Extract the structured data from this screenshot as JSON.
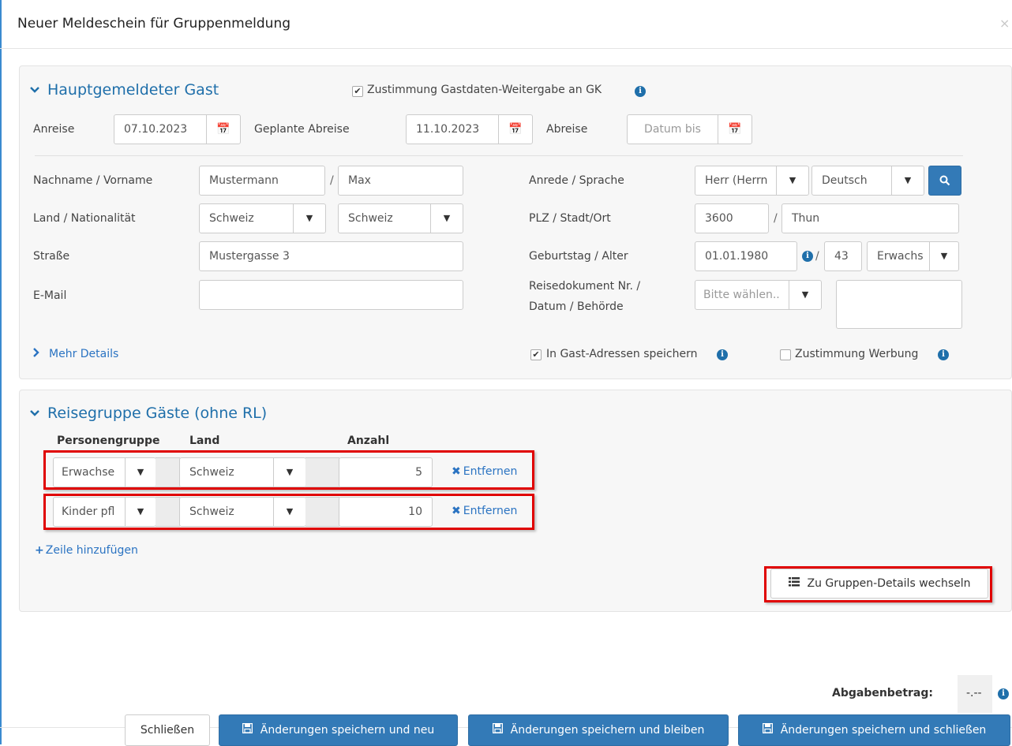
{
  "modal": {
    "title": "Neuer Meldeschein für Gruppenmeldung",
    "close": "×"
  },
  "main_guest": {
    "heading": "Hauptgemeldeter Gast",
    "consent_label": "Zustimmung Gastdaten-Weitergabe an GK",
    "consent_checked": true,
    "arrival_label": "Anreise",
    "arrival_value": "07.10.2023",
    "planned_departure_label": "Geplante Abreise",
    "planned_departure_value": "11.10.2023",
    "departure_label": "Abreise",
    "departure_placeholder": "Datum bis",
    "name_label": "Nachname / Vorname",
    "last_name": "Mustermann",
    "first_name": "Max",
    "salutation_label": "Anrede / Sprache",
    "salutation_value": "Herr (Herrn",
    "language_value": "Deutsch",
    "country_label": "Land / Nationalität",
    "country_value": "Schweiz",
    "nationality_value": "Schweiz",
    "zip_city_label": "PLZ / Stadt/Ort",
    "zip_value": "3600",
    "city_value": "Thun",
    "street_label": "Straße",
    "street_value": "Mustergasse 3",
    "birthday_label": "Geburtstag / Alter",
    "birthday_value": "01.01.1980",
    "age_value": "43",
    "age_group_value": "Erwachs",
    "email_label": "E-Mail",
    "email_value": "",
    "travel_doc_label_line1": "Reisedokument Nr. /",
    "travel_doc_label_line2": "Datum / Behörde",
    "travel_doc_placeholder": "Bitte wählen..",
    "more_details": "Mehr Details",
    "save_address_label": "In Gast-Adressen speichern",
    "save_address_checked": true,
    "advertising_label": "Zustimmung Werbung",
    "advertising_checked": false,
    "slash": "/"
  },
  "group": {
    "heading": "Reisegruppe Gäste (ohne RL)",
    "col_person_group": "Personengruppe",
    "col_country": "Land",
    "col_count": "Anzahl",
    "rows": [
      {
        "person_group": "Erwachse",
        "country": "Schweiz",
        "count": "5",
        "remove": "Entfernen"
      },
      {
        "person_group": "Kinder pfl",
        "country": "Schweiz",
        "count": "10",
        "remove": "Entfernen"
      }
    ],
    "add_row": "Zeile hinzufügen",
    "details_button": "Zu Gruppen-Details wechseln"
  },
  "fee": {
    "label": "Abgabenbetrag:",
    "value": "-.--"
  },
  "footer": {
    "close": "Schließen",
    "save_new": "Änderungen speichern und neu",
    "save_stay": "Änderungen speichern und bleiben",
    "save_close": "Änderungen speichern und schließen"
  },
  "colors": {
    "accent": "#337ab7",
    "heading": "#1f6faa",
    "highlight": "#e00000"
  }
}
